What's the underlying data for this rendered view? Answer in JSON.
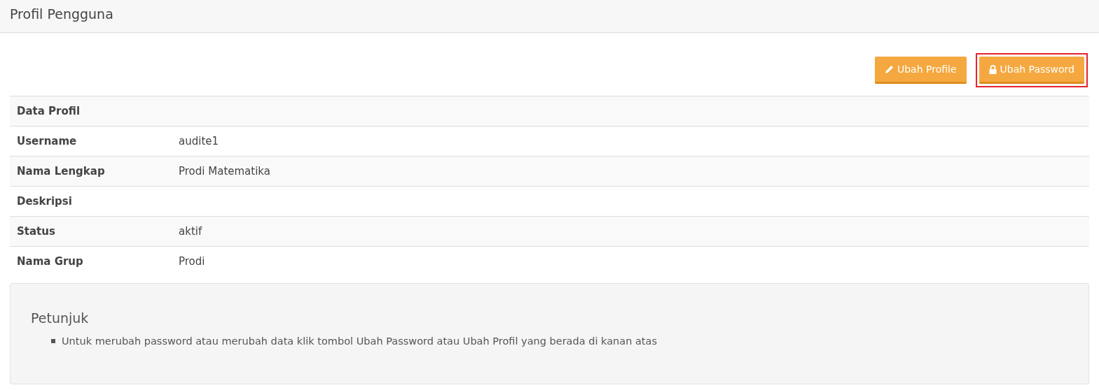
{
  "header": {
    "title": "Profil Pengguna"
  },
  "buttons": [
    {
      "kind": "edit",
      "label": "Ubah Profile",
      "highlighted": false
    },
    {
      "kind": "lock",
      "label": "Ubah Password",
      "highlighted": true
    }
  ],
  "table": {
    "heading": "Data Profil",
    "rows": [
      {
        "label": "Username",
        "value": "audite1"
      },
      {
        "label": "Nama Lengkap",
        "value": "Prodi Matematika"
      },
      {
        "label": "Deskripsi",
        "value": ""
      },
      {
        "label": "Status",
        "value": "aktif"
      },
      {
        "label": "Nama Grup",
        "value": "Prodi"
      }
    ]
  },
  "hint": {
    "title": "Petunjuk",
    "items": [
      "Untuk merubah password atau merubah data klik tombol Ubah Password atau Ubah Profil yang berada di kanan atas"
    ]
  }
}
